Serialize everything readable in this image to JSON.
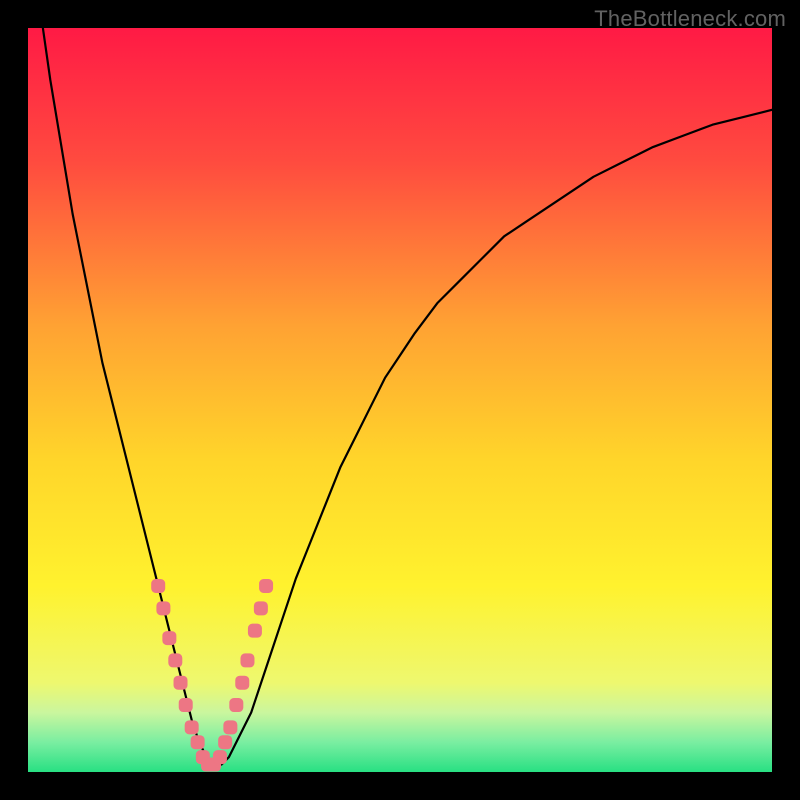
{
  "watermark": {
    "text": "TheBottleneck.com"
  },
  "colors": {
    "frame": "#000000",
    "curve_stroke": "#000000",
    "marker_fill": "#ed7684",
    "marker_stroke": "#ed7684",
    "gradient_stops": [
      {
        "pct": 0,
        "color": "#ff1a45"
      },
      {
        "pct": 18,
        "color": "#ff4b3f"
      },
      {
        "pct": 40,
        "color": "#ffa233"
      },
      {
        "pct": 58,
        "color": "#ffd52a"
      },
      {
        "pct": 75,
        "color": "#fff22e"
      },
      {
        "pct": 88,
        "color": "#eef86f"
      },
      {
        "pct": 92,
        "color": "#caf69e"
      },
      {
        "pct": 96,
        "color": "#7aeea1"
      },
      {
        "pct": 100,
        "color": "#28e083"
      }
    ]
  },
  "chart_data": {
    "type": "line",
    "title": "",
    "xlabel": "",
    "ylabel": "",
    "xlim": [
      0,
      100
    ],
    "ylim": [
      0,
      100
    ],
    "series": [
      {
        "name": "bottleneck-curve",
        "x": [
          2,
          3,
          4,
          5,
          6,
          7,
          8,
          9,
          10,
          11,
          12,
          13,
          14,
          15,
          16,
          17,
          18,
          19,
          20,
          21,
          22,
          23,
          24,
          25,
          26,
          27,
          28,
          30,
          32,
          34,
          36,
          38,
          40,
          42,
          44,
          46,
          48,
          50,
          52,
          55,
          58,
          61,
          64,
          67,
          70,
          73,
          76,
          80,
          84,
          88,
          92,
          96,
          100
        ],
        "y": [
          100,
          93,
          87,
          81,
          75,
          70,
          65,
          60,
          55,
          51,
          47,
          43,
          39,
          35,
          31,
          27,
          23,
          19,
          15,
          11,
          7,
          4,
          2,
          1,
          1,
          2,
          4,
          8,
          14,
          20,
          26,
          31,
          36,
          41,
          45,
          49,
          53,
          56,
          59,
          63,
          66,
          69,
          72,
          74,
          76,
          78,
          80,
          82,
          84,
          85.5,
          87,
          88,
          89
        ]
      }
    ],
    "markers": {
      "name": "highlighted-points",
      "x": [
        17.5,
        18.2,
        19.0,
        19.8,
        20.5,
        21.2,
        22.0,
        22.8,
        23.5,
        24.2,
        25.0,
        25.8,
        26.5,
        27.2,
        28.0,
        28.8,
        29.5,
        30.5,
        31.3,
        32.0
      ],
      "y": [
        25,
        22,
        18,
        15,
        12,
        9,
        6,
        4,
        2,
        1,
        1,
        2,
        4,
        6,
        9,
        12,
        15,
        19,
        22,
        25
      ]
    }
  }
}
